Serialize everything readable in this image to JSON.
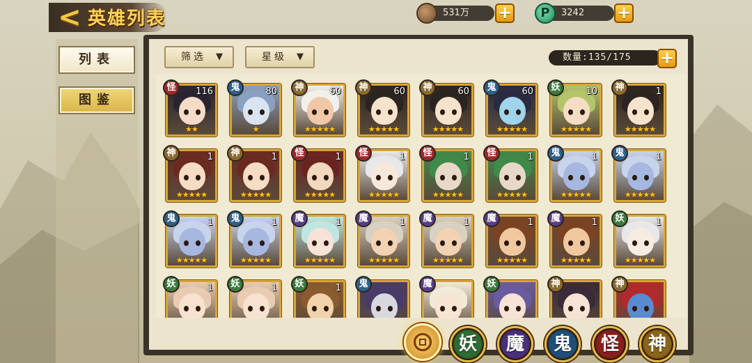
{
  "header": {
    "title": "英雄列表",
    "back_icon": "back-arrow-icon",
    "coins": "531万",
    "jade": "3242",
    "jade_glyph": "P"
  },
  "sidebar": {
    "tabs": [
      {
        "label": "列表",
        "active": true
      },
      {
        "label": "图鉴",
        "active": false
      }
    ]
  },
  "toolbar": {
    "filter_label": "筛选",
    "star_label": "星级",
    "count": "数量:135/175"
  },
  "heroes": [
    {
      "type": "怪",
      "level": "116",
      "stars": "★★",
      "colors": [
        "#2a2430",
        "#f4dcc8"
      ]
    },
    {
      "type": "鬼",
      "level": "80",
      "stars": "★",
      "colors": [
        "#8aa0c0",
        "#d9e4f2"
      ]
    },
    {
      "type": "神",
      "level": "60",
      "stars": "★★★★★",
      "colors": [
        "#f2f0ea",
        "#f0c8a8"
      ]
    },
    {
      "type": "神",
      "level": "60",
      "stars": "★★★★★",
      "colors": [
        "#2c2420",
        "#f7e2cc"
      ]
    },
    {
      "type": "神",
      "level": "60",
      "stars": "★★★★★",
      "colors": [
        "#2c2420",
        "#f7e2cc"
      ]
    },
    {
      "type": "鬼",
      "level": "60",
      "stars": "★★★★★",
      "colors": [
        "#2a2a40",
        "#9fd4ea"
      ]
    },
    {
      "type": "妖",
      "level": "10",
      "stars": "★★★★★",
      "colors": [
        "#b4c46a",
        "#f5dcc4"
      ]
    },
    {
      "type": "神",
      "level": "1",
      "stars": "★★★★★",
      "colors": [
        "#2c2420",
        "#f7e2cc"
      ]
    },
    {
      "type": "神",
      "level": "1",
      "stars": "★★★★★",
      "colors": [
        "#6a2a20",
        "#f7dcc4"
      ]
    },
    {
      "type": "神",
      "level": "1",
      "stars": "★★★★★",
      "colors": [
        "#6a2a20",
        "#f7dcc4"
      ]
    },
    {
      "type": "怪",
      "level": "1",
      "stars": "★★★★★",
      "colors": [
        "#6a2420",
        "#f2d8bc"
      ]
    },
    {
      "type": "怪",
      "level": "1",
      "stars": "★★★★★",
      "colors": [
        "#e8e8ea",
        "#f7e8dc"
      ]
    },
    {
      "type": "怪",
      "level": "1",
      "stars": "★★★★★",
      "colors": [
        "#3f8a4a",
        "#e8d8c8"
      ]
    },
    {
      "type": "怪",
      "level": "1",
      "stars": "★★★★★",
      "colors": [
        "#3f8a4a",
        "#e8d8c8"
      ]
    },
    {
      "type": "鬼",
      "level": "1",
      "stars": "★★★★★",
      "colors": [
        "#c8d4ec",
        "#a6b8e0"
      ]
    },
    {
      "type": "鬼",
      "level": "1",
      "stars": "★★★★★",
      "colors": [
        "#c8d4ec",
        "#a6b8e0"
      ]
    },
    {
      "type": "鬼",
      "level": "1",
      "stars": "★★★★★",
      "colors": [
        "#c8d4ec",
        "#a6b8e0"
      ]
    },
    {
      "type": "鬼",
      "level": "1",
      "stars": "★★★★★",
      "colors": [
        "#c8d4ec",
        "#a6b8e0"
      ]
    },
    {
      "type": "魔",
      "level": "1",
      "stars": "★★★★★",
      "colors": [
        "#bfe6e0",
        "#f7e2d8"
      ]
    },
    {
      "type": "魔",
      "level": "1",
      "stars": "★★★★★",
      "colors": [
        "#d8d0c0",
        "#f2d2b2"
      ]
    },
    {
      "type": "魔",
      "level": "1",
      "stars": "★★★★★",
      "colors": [
        "#d8d0c0",
        "#f2d2b2"
      ]
    },
    {
      "type": "魔",
      "level": "1",
      "stars": "★★★★★",
      "colors": [
        "#7a4424",
        "#f0c8a0"
      ]
    },
    {
      "type": "魔",
      "level": "1",
      "stars": "★★★★★",
      "colors": [
        "#7a4424",
        "#f0c8a0"
      ]
    },
    {
      "type": "妖",
      "level": "1",
      "stars": "★★★★★",
      "colors": [
        "#e8e8ea",
        "#f7ece2"
      ]
    },
    {
      "type": "妖",
      "level": "1",
      "stars": "",
      "colors": [
        "#e8ccb0",
        "#f7e2d0"
      ]
    },
    {
      "type": "妖",
      "level": "1",
      "stars": "",
      "colors": [
        "#e8ccb0",
        "#f7e2d0"
      ]
    },
    {
      "type": "妖",
      "level": "1",
      "stars": "",
      "colors": [
        "#8a5a30",
        "#f2d2aa"
      ]
    },
    {
      "type": "鬼",
      "level": "",
      "stars": "",
      "colors": [
        "#4a3a6a",
        "#d8d8e0"
      ]
    },
    {
      "type": "魔",
      "level": "",
      "stars": "",
      "colors": [
        "#f2ead8",
        "#f7e4d2"
      ]
    },
    {
      "type": "妖",
      "level": "",
      "stars": "",
      "colors": [
        "#6a5aa0",
        "#f7e2d6"
      ]
    },
    {
      "type": "神",
      "level": "",
      "stars": "",
      "colors": [
        "#3a2a3a",
        "#f7e2d6"
      ]
    },
    {
      "type": "神",
      "level": "",
      "stars": "",
      "colors": [
        "#b22a2a",
        "#5a8ad0"
      ]
    }
  ],
  "categories": [
    {
      "label": "妖",
      "color": "#2f6b34"
    },
    {
      "label": "魔",
      "color": "#4a2f7a"
    },
    {
      "label": "鬼",
      "color": "#1f4f78"
    },
    {
      "label": "怪",
      "color": "#8a1f1f"
    },
    {
      "label": "神",
      "color": "#8a6418"
    }
  ],
  "type_classes": {
    "鬼": "b-gui",
    "神": "b-shen",
    "怪": "b-guai",
    "妖": "b-yao",
    "魔": "b-mo"
  }
}
